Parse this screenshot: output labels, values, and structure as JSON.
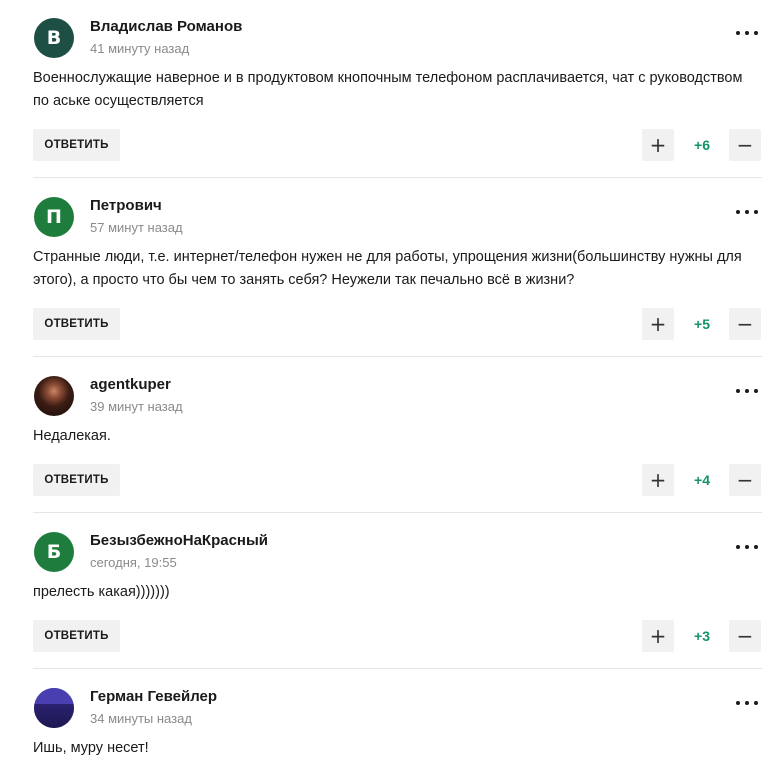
{
  "theme": {
    "avatar_green": "#1e7d3c",
    "avatar_teal": "#1d4f44",
    "score_color": "#14936b",
    "button_bg": "#f1f1f1"
  },
  "comments": [
    {
      "author": "Владислав Романов",
      "avatar_letter": "В",
      "time": "41 минуту назад",
      "text": "Военнослужащие наверное и в продуктовом кнопочным телефоном расплачивается, чат с руководством по аське осуществляется",
      "reply_label": "ОТВЕТИТЬ",
      "score": "+6",
      "more_icon": "more-dots-icon"
    },
    {
      "author": "Петрович",
      "avatar_letter": "П",
      "time": "57 минут назад",
      "text": "Странные люди, т.е. интернет/телефон нужен не для работы, упрощения жизни(большинству нужны для этого), а просто что бы чем то занять себя? Неужели так печально всё в жизни?",
      "reply_label": "ОТВЕТИТЬ",
      "score": "+5",
      "more_icon": "more-dots-icon"
    },
    {
      "author": "agentkuper",
      "avatar_letter": "",
      "time": "39 минут назад",
      "text": "Недалекая.",
      "reply_label": "ОТВЕТИТЬ",
      "score": "+4",
      "more_icon": "more-dots-icon"
    },
    {
      "author": "БезызбежноНаКрасный",
      "avatar_letter": "Б",
      "time": "сегодня, 19:55",
      "text": "прелесть какая)))))))",
      "reply_label": "ОТВЕТИТЬ",
      "score": "+3",
      "more_icon": "more-dots-icon"
    },
    {
      "author": "Герман Гевейлер",
      "avatar_letter": "",
      "time": "34 минуты назад",
      "text": "Ишь, муру несет!",
      "more_icon": "more-dots-icon"
    }
  ],
  "controls": {
    "plus_glyph": "+",
    "minus_glyph": "−"
  }
}
